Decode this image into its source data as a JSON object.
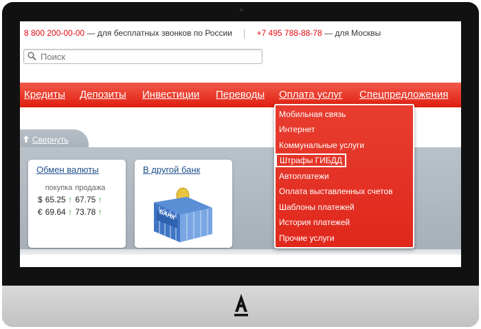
{
  "topbar": {
    "phone_free": "8 800 200-00-00",
    "phone_free_note": "— для бесплатных звонков по России",
    "phone_moscow": "+7 495 788-88-78",
    "phone_moscow_note": "— для Москвы"
  },
  "search": {
    "placeholder": "Поиск"
  },
  "nav": [
    "Кредиты",
    "Депозиты",
    "Инвестиции",
    "Переводы",
    "Оплата услуг",
    "Спецпредложения"
  ],
  "collapse_label": "Свернуть",
  "exchange": {
    "title": "Обмен валюты",
    "buy_header": "покупка",
    "sell_header": "продажа",
    "rows": [
      {
        "currency": "$",
        "buy": "65.25",
        "sell": "67.75"
      },
      {
        "currency": "€",
        "buy": "69.64",
        "sell": "73.78"
      }
    ]
  },
  "other_bank": {
    "title": "В другой банк",
    "bank_label": "БАНК"
  },
  "payments_menu": [
    "Мобильная связь",
    "Интернет",
    "Коммунальные услуги",
    "Штрафы ГИБДД",
    "Автоплатежи",
    "Оплата выставленных счетов",
    "Шаблоны платежей",
    "История платежей",
    "Прочие услуги"
  ],
  "colors": {
    "brand_red": "#e30613",
    "link_blue": "#1f4e8c",
    "panel_gray": "#a7b0b9"
  },
  "icons": {
    "search": "magnifier-icon",
    "collapse": "arrow-up-icon",
    "up_arrow": "↑",
    "logo": "alfa-bank-logo"
  }
}
